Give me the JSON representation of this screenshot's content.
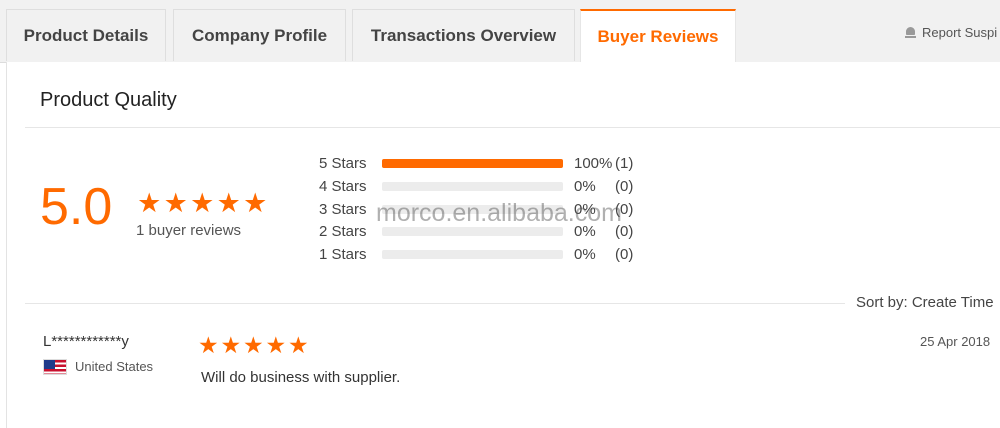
{
  "tabs": [
    {
      "label": "Product Details",
      "active": false
    },
    {
      "label": "Company Profile",
      "active": false
    },
    {
      "label": "Transactions Overview",
      "active": false
    },
    {
      "label": "Buyer Reviews",
      "active": true
    }
  ],
  "report": {
    "label": "Report Suspi",
    "icon": "alarm-icon"
  },
  "quality": {
    "title": "Product Quality",
    "score": "5.0",
    "stars": 5,
    "buyer_reviews": "1 buyer reviews",
    "distribution": [
      {
        "label": "5 Stars",
        "fraction": 1.0,
        "percent": "100%",
        "count": "(1)"
      },
      {
        "label": "4 Stars",
        "fraction": 0,
        "percent": "0%",
        "count": "(0)"
      },
      {
        "label": "3 Stars",
        "fraction": 0,
        "percent": "0%",
        "count": "(0)"
      },
      {
        "label": "2 Stars",
        "fraction": 0,
        "percent": "0%",
        "count": "(0)"
      },
      {
        "label": "1 Stars",
        "fraction": 0,
        "percent": "0%",
        "count": "(0)"
      }
    ]
  },
  "watermark": "morco.en.alibaba.com",
  "sort": {
    "label": "Sort by: Create Time"
  },
  "reviews": [
    {
      "name": "L************y",
      "country": "United States",
      "flag": "us-flag-icon",
      "stars": 5,
      "date": "25 Apr 2018",
      "text": "Will do business with supplier."
    }
  ],
  "colors": {
    "accent": "#ff6a00",
    "track": "#ececec",
    "tab_bg": "#f1f1f1"
  }
}
